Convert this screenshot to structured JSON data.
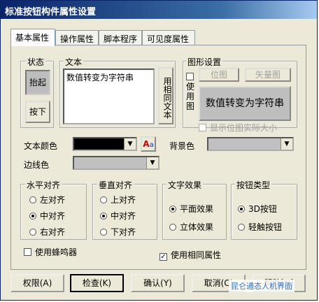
{
  "window": {
    "title": "标准按钮构件属性设置"
  },
  "tabs": [
    "基本属性",
    "操作属性",
    "脚本程序",
    "可见度属性"
  ],
  "state": {
    "label": "状态",
    "btn_up": "抬起",
    "btn_down": "按下"
  },
  "text": {
    "label": "文本",
    "value": "数值转变为字符串",
    "same_text_btn": "用相同文本"
  },
  "graphic": {
    "label": "图形设置",
    "use_graphic": "使用图",
    "bitmap_btn": "位图",
    "vector_btn": "矢量图",
    "preview": "数值转变为字符串",
    "show_actual_size": "显示位图实际大小"
  },
  "colors": {
    "text_color_label": "文本颜色",
    "bg_color_label": "背景色",
    "border_color_label": "边线色",
    "text_color": "#000000",
    "bg_color": "#c0c0c0",
    "border_color": "#c0c0c0",
    "font_icon": "font-icon"
  },
  "h_align": {
    "label": "水平对齐",
    "options": [
      "左对齐",
      "中对齐",
      "右对齐"
    ],
    "selected": "中对齐"
  },
  "v_align": {
    "label": "垂直对齐",
    "options": [
      "上对齐",
      "中对齐",
      "下对齐"
    ],
    "selected": "中对齐"
  },
  "text_effect": {
    "label": "文字效果",
    "options": [
      "平面效果",
      "立体效果"
    ],
    "selected": "平面效果"
  },
  "button_type": {
    "label": "按钮类型",
    "options": [
      "3D按钮",
      "轻触按钮"
    ],
    "selected": "3D按钮"
  },
  "use_buzzer": {
    "label": "使用蜂鸣器",
    "checked": false
  },
  "use_same_props": {
    "label": "使用相同属性",
    "checked": true
  },
  "bottom": {
    "permission": "权限(A)",
    "check": "检查(K)",
    "ok": "确认(Y)",
    "cancel": "取消(C)",
    "help": "帮助[H]",
    "watermark": "昆仑通态人机界面"
  }
}
